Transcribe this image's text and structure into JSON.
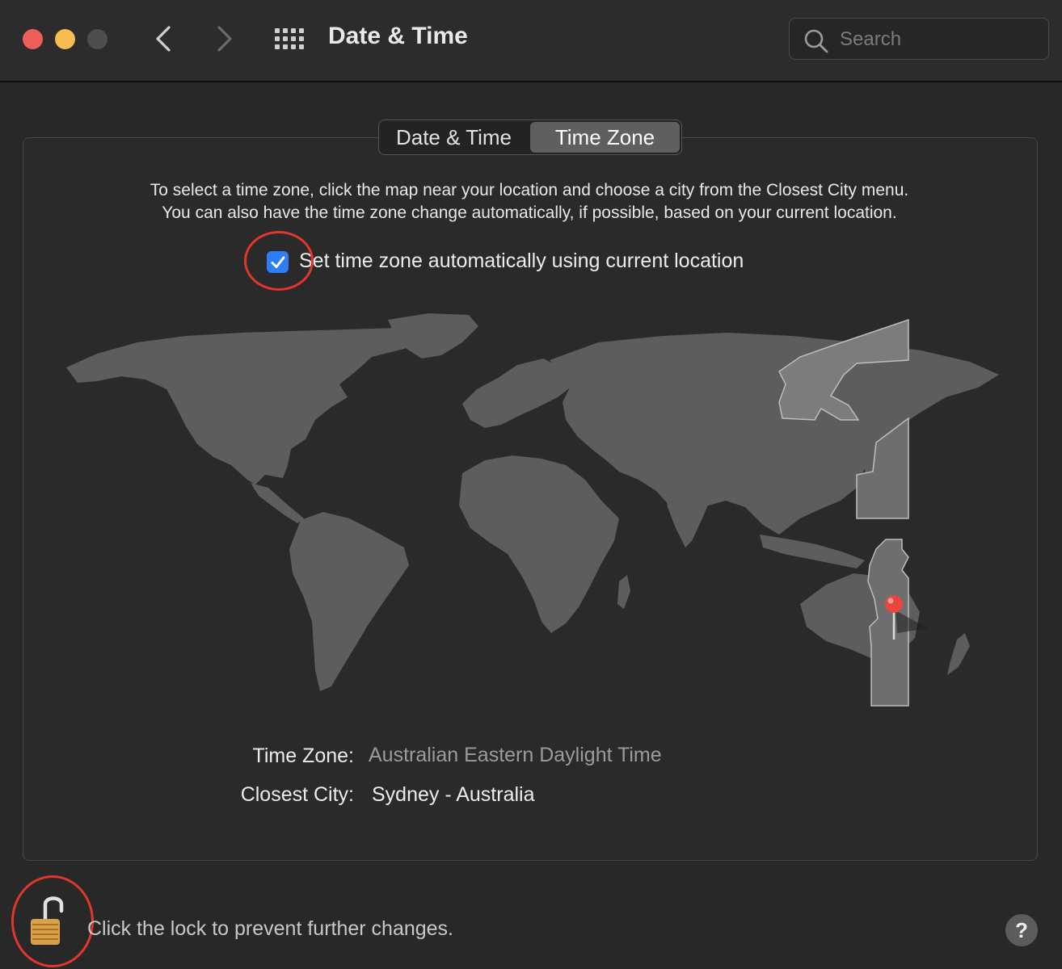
{
  "window": {
    "title": "Date & Time",
    "search_placeholder": "Search"
  },
  "tabs": [
    {
      "label": "Date & Time",
      "selected": false
    },
    {
      "label": "Time Zone",
      "selected": true
    }
  ],
  "description": {
    "line1": "To select a time zone, click the map near your location and choose a city from the Closest City menu.",
    "line2": "You can also have the time zone change automatically, if possible, based on your current location."
  },
  "auto_timezone": {
    "label": "Set time zone automatically using current location",
    "checked": true
  },
  "time_zone": {
    "label": "Time Zone:",
    "value": "Australian Eastern Daylight Time"
  },
  "closest_city": {
    "label": "Closest City:",
    "value": "Sydney - Australia"
  },
  "lock": {
    "text": "Click the lock to prevent further changes.",
    "state": "unlocked"
  },
  "help": {
    "label": "?"
  },
  "colors": {
    "accent_blue": "#2f7df6",
    "annotation_red": "#e0362c",
    "pin_red": "#e8473e"
  }
}
